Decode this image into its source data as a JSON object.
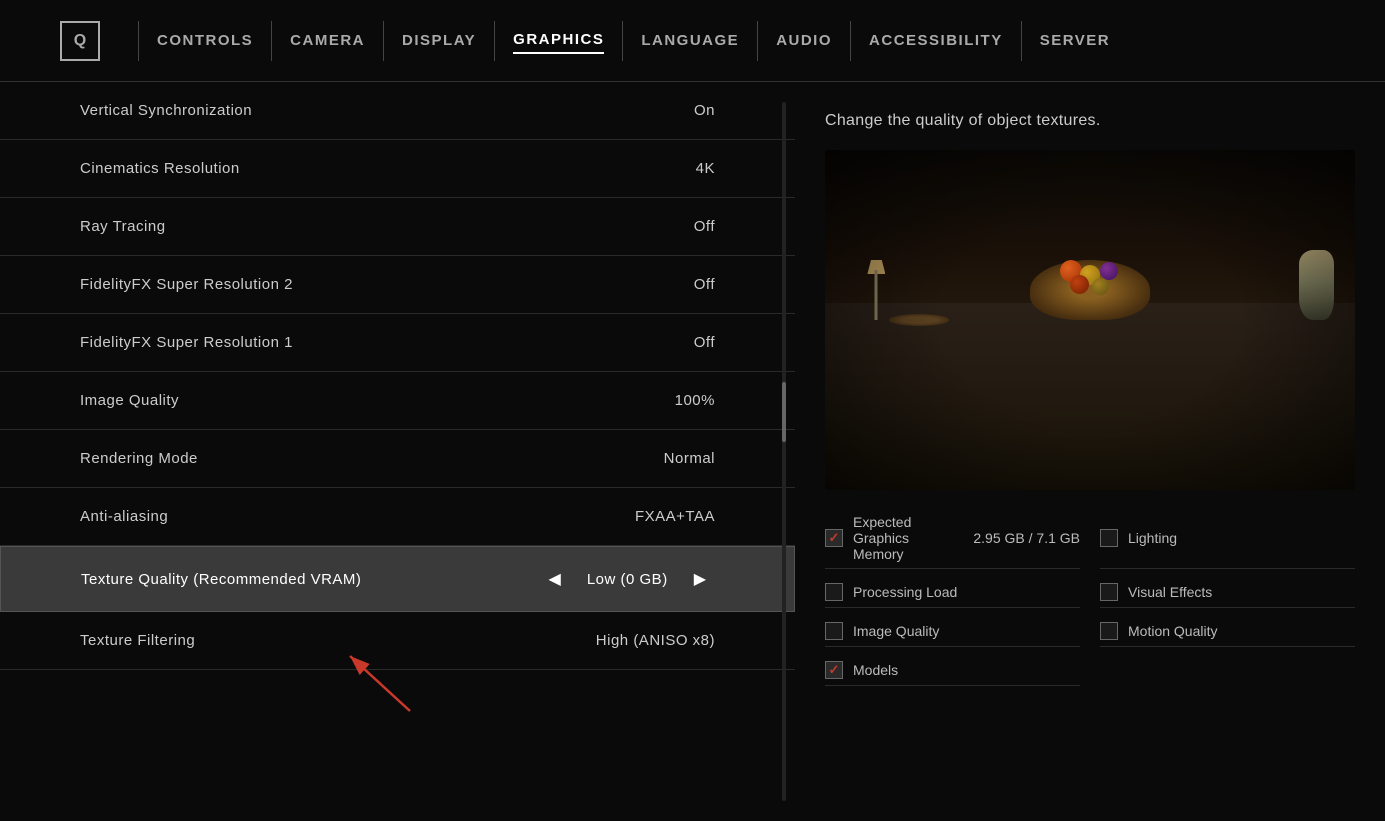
{
  "nav": {
    "logo": "Q",
    "items": [
      {
        "label": "CONTROLS",
        "active": false
      },
      {
        "label": "CAMERA",
        "active": false
      },
      {
        "label": "DISPLAY",
        "active": false
      },
      {
        "label": "GRAPHICS",
        "active": true
      },
      {
        "label": "LANGUAGE",
        "active": false
      },
      {
        "label": "AUDIO",
        "active": false
      },
      {
        "label": "ACCESSIBILITY",
        "active": false
      },
      {
        "label": "SERVER",
        "active": false
      }
    ]
  },
  "settings": {
    "rows": [
      {
        "label": "Vertical Synchronization",
        "value": "On",
        "highlighted": false
      },
      {
        "label": "Cinematics Resolution",
        "value": "4K",
        "highlighted": false
      },
      {
        "label": "Ray Tracing",
        "value": "Off",
        "highlighted": false
      },
      {
        "label": "FidelityFX Super Resolution 2",
        "value": "Off",
        "highlighted": false
      },
      {
        "label": "FidelityFX Super Resolution 1",
        "value": "Off",
        "highlighted": false
      },
      {
        "label": "Image Quality",
        "value": "100%",
        "highlighted": false
      },
      {
        "label": "Rendering Mode",
        "value": "Normal",
        "highlighted": false
      },
      {
        "label": "Anti-aliasing",
        "value": "FXAA+TAA",
        "highlighted": false
      },
      {
        "label": "Texture Quality (Recommended VRAM)",
        "value": "Low (0 GB)",
        "highlighted": true
      },
      {
        "label": "Texture Filtering",
        "value": "High (ANISO x8)",
        "highlighted": false
      }
    ]
  },
  "preview": {
    "description": "Change the quality of object textures.",
    "checkboxes": [
      {
        "label": "Expected Graphics Memory",
        "checked": true,
        "value": "2.95 GB / 7.1 GB",
        "col": 0
      },
      {
        "label": "Lighting",
        "checked": false,
        "value": "",
        "col": 1
      },
      {
        "label": "Processing Load",
        "checked": false,
        "value": "",
        "col": 0
      },
      {
        "label": "Visual Effects",
        "checked": false,
        "value": "",
        "col": 1
      },
      {
        "label": "Image Quality",
        "checked": false,
        "value": "",
        "col": 0
      },
      {
        "label": "Motion Quality",
        "checked": false,
        "value": "",
        "col": 1
      },
      {
        "label": "Models",
        "checked": true,
        "value": "",
        "col": 0
      }
    ]
  }
}
